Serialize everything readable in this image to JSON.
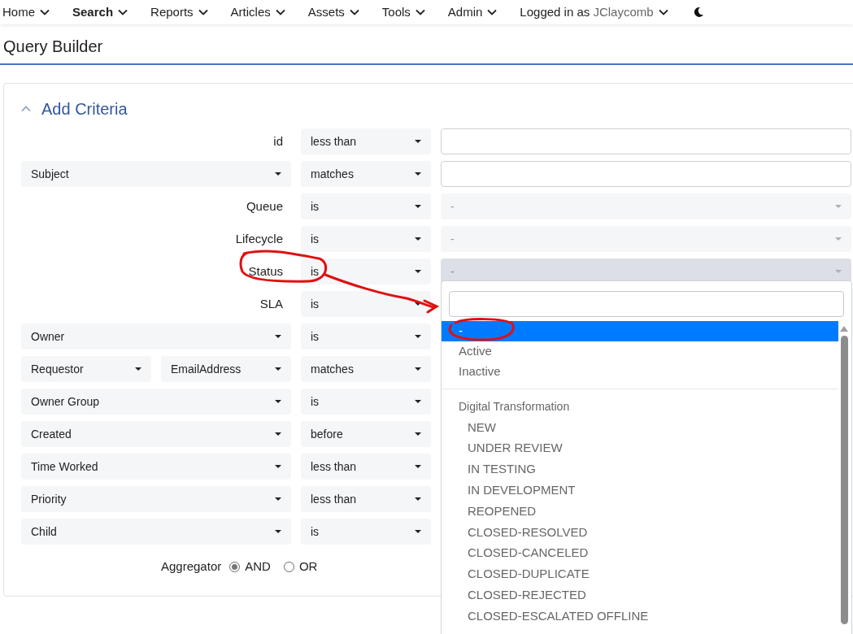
{
  "nav": [
    {
      "label": "Home",
      "selected": false
    },
    {
      "label": "Search",
      "selected": true
    },
    {
      "label": "Reports",
      "selected": false
    },
    {
      "label": "Articles",
      "selected": false
    },
    {
      "label": "Assets",
      "selected": false
    },
    {
      "label": "Tools",
      "selected": false
    },
    {
      "label": "Admin",
      "selected": false
    }
  ],
  "user": {
    "prefix": "Logged in as",
    "name": "JClaycomb"
  },
  "page_title": "Query Builder",
  "section": {
    "title": "Add Criteria",
    "expanded": true
  },
  "rows": [
    {
      "kind": "label",
      "fields": [
        "id"
      ],
      "operator": "less than",
      "value_input": true
    },
    {
      "kind": "select",
      "fields": [
        "Subject"
      ],
      "operator": "matches",
      "value_input": true
    },
    {
      "kind": "label",
      "fields": [
        "Queue"
      ],
      "operator": "is",
      "value_select": {
        "text": "-",
        "expanded": false
      }
    },
    {
      "kind": "label",
      "fields": [
        "Lifecycle"
      ],
      "operator": "is",
      "value_select": {
        "text": "-",
        "expanded": false
      }
    },
    {
      "kind": "label",
      "fields": [
        "Status"
      ],
      "operator": "is",
      "value_select": {
        "text": "-",
        "expanded": true
      }
    },
    {
      "kind": "label",
      "fields": [
        "SLA"
      ],
      "operator": "is"
    },
    {
      "kind": "select",
      "fields": [
        "Owner"
      ],
      "operator": "is"
    },
    {
      "kind": "double",
      "fields": [
        "Requestor",
        "EmailAddress"
      ],
      "operator": "matches"
    },
    {
      "kind": "select",
      "fields": [
        "Owner Group"
      ],
      "operator": "is"
    },
    {
      "kind": "select",
      "fields": [
        "Created"
      ],
      "operator": "before"
    },
    {
      "kind": "select",
      "fields": [
        "Time Worked"
      ],
      "operator": "less than"
    },
    {
      "kind": "select",
      "fields": [
        "Priority"
      ],
      "operator": "less than"
    },
    {
      "kind": "select",
      "fields": [
        "Child"
      ],
      "operator": "is"
    }
  ],
  "aggregator": {
    "label": "Aggregator",
    "options": [
      {
        "label": "AND",
        "selected": true
      },
      {
        "label": "OR",
        "selected": false
      }
    ]
  },
  "dropdown": {
    "options": [
      {
        "label": "-",
        "selected": true
      },
      {
        "label": "Active",
        "selected": false
      },
      {
        "label": "Inactive",
        "selected": false
      }
    ],
    "group": {
      "label": "Digital Transformation",
      "options": [
        {
          "label": "NEW",
          "selected": false
        },
        {
          "label": "UNDER REVIEW",
          "selected": false
        },
        {
          "label": "IN TESTING",
          "selected": false
        },
        {
          "label": "IN DEVELOPMENT",
          "selected": false
        },
        {
          "label": "REOPENED",
          "selected": false
        },
        {
          "label": "CLOSED-RESOLVED",
          "selected": false
        },
        {
          "label": "CLOSED-CANCELED",
          "selected": false
        },
        {
          "label": "CLOSED-DUPLICATE",
          "selected": false
        },
        {
          "label": "CLOSED-REJECTED",
          "selected": false
        },
        {
          "label": "CLOSED-ESCALATED OFFLINE",
          "selected": false
        }
      ]
    }
  }
}
